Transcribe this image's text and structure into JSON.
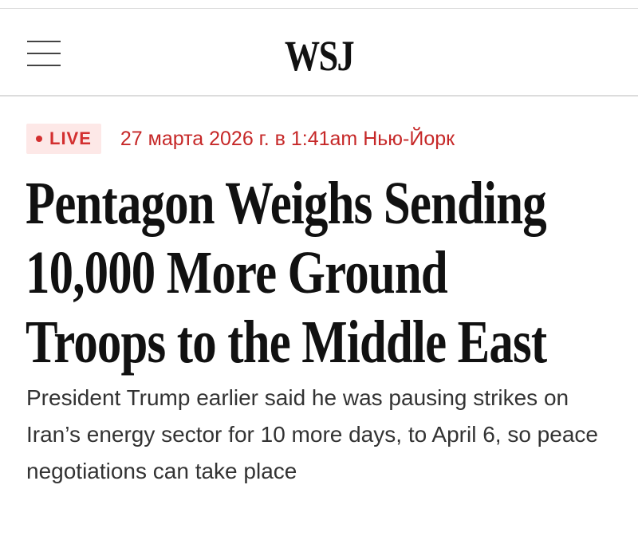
{
  "header": {
    "logo": "WSJ",
    "menu_icon": "hamburger-menu-icon"
  },
  "article": {
    "live_label": "LIVE",
    "timestamp": "27 марта 2026 г. в 1:41am Нью-Йорк",
    "headline_lines": [
      "Pentagon Weighs Sending",
      "10,000 More Ground",
      "Troops to the Middle East"
    ],
    "subhead": "President Trump earlier said he was pausing strikes on Iran’s energy sector for 10 more days, to April 6, so peace negotiations can take place"
  },
  "colors": {
    "live_red": "#d32f2f",
    "live_bg": "#fde8e7",
    "headline": "#111111",
    "subhead": "#333333"
  }
}
